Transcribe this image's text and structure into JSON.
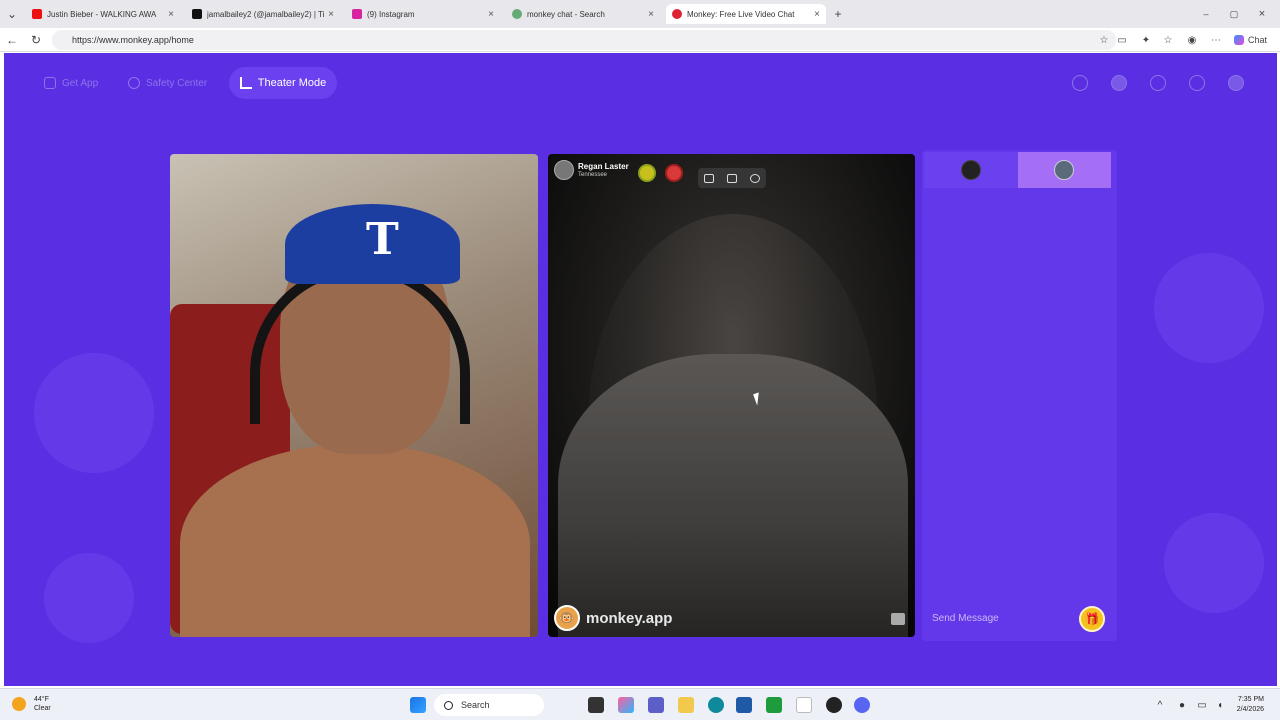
{
  "browser": {
    "tabs": [
      {
        "label": "Justin Bieber - WALKING AWA",
        "active": false
      },
      {
        "label": "jamalbailey2 (@jamalbailey2) | Tik",
        "active": false
      },
      {
        "label": "(9) Instagram",
        "active": false
      },
      {
        "label": "monkey chat - Search",
        "active": false
      },
      {
        "label": "Monkey: Free Live Video Chat",
        "active": true
      }
    ],
    "url": "https://www.monkey.app/home",
    "chat_label": "Chat"
  },
  "site": {
    "nav": {
      "get_app": "Get App",
      "safety_center": "Safety Center",
      "theater_mode": "Theater Mode"
    },
    "remote_user": {
      "name": "Regan Laster",
      "location": "Tennessee"
    },
    "watermark": "monkey.app",
    "chat": {
      "placeholder": "Send Message"
    }
  },
  "taskbar": {
    "weather_temp": "44°F",
    "weather_desc": "Clear",
    "search_label": "Search",
    "time": "7:35 PM",
    "date": "2/4/2026"
  },
  "colors": {
    "page_bg": "#5a2fe4",
    "panel": "#6338ea",
    "accent": "#a46ff5",
    "gift": "#f5c21b"
  }
}
